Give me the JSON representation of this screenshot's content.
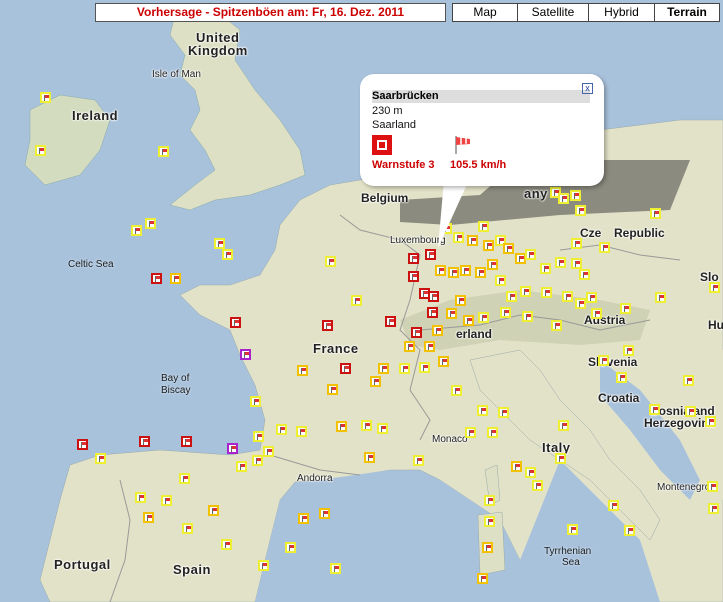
{
  "title": "Vorhersage - Spitzenböen am: Fr, 16. Dez. 2011",
  "map_types": [
    {
      "label": "Map",
      "active": false
    },
    {
      "label": "Satellite",
      "active": false
    },
    {
      "label": "Hybrid",
      "active": false
    },
    {
      "label": "Terrain",
      "active": true
    }
  ],
  "popup": {
    "station": "Saarbrücken",
    "altitude": "230 m",
    "region": "Saarland",
    "warn_level": "Warnstufe 3",
    "gust": "105.5  km/h",
    "close_label": "x"
  },
  "labels": {
    "uk": "United",
    "uk2": "Kingdom",
    "isle_of_man": "Isle of Man",
    "ireland": "Ireland",
    "celtic_sea": "Celtic Sea",
    "belgium": "Belgium",
    "luxembourg": "Luxembourg",
    "germany": "any",
    "czech": "Republic",
    "cze": "Cze",
    "france": "France",
    "bay1": "Bay of",
    "bay2": "Biscay",
    "switzerland": "erland",
    "austria": "Austria",
    "slovenia": "Slovenia",
    "croatia": "Croatia",
    "bosnia1": "Bosnia and",
    "bosnia2": "Herzegovina",
    "montenegro": "Montenegro",
    "monaco": "Monaco",
    "andorra": "Andorra",
    "italy": "Italy",
    "portugal": "Portugal",
    "spain": "Spain",
    "tyrrhenian1": "Tyrrhenian",
    "tyrrhenian2": "Sea",
    "slo": "Slo",
    "hu": "Hu"
  },
  "colors": {
    "level0": "#eeee33",
    "level1": "#f2c200",
    "level2": "#f0a000",
    "level3": "#cc1111",
    "level4": "#aa22cc"
  },
  "markers_note": "warning level per station marker (0=yellow,1=gold,2=orange,3=red,4=purple)"
}
